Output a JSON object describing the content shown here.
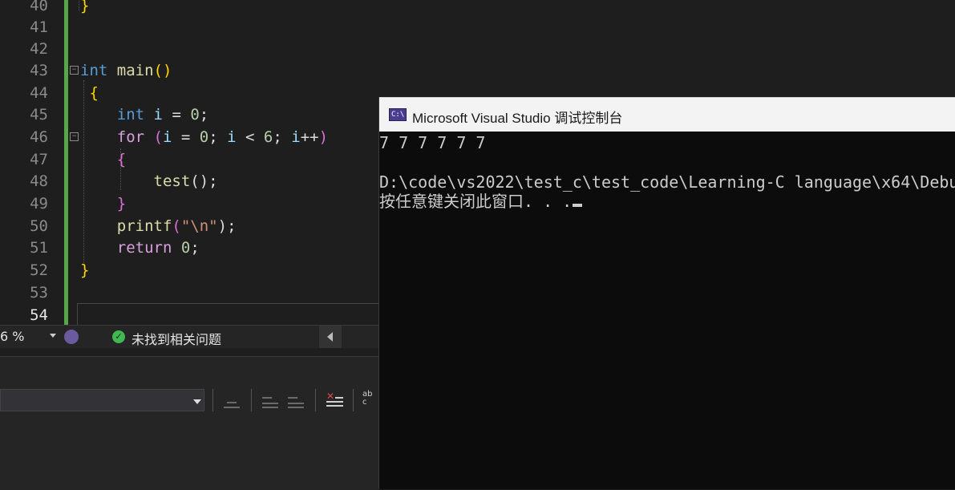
{
  "editor": {
    "line_numbers": [
      "40",
      "41",
      "42",
      "43",
      "44",
      "45",
      "46",
      "47",
      "48",
      "49",
      "50",
      "51",
      "52",
      "53",
      "54"
    ],
    "code": {
      "l40": "}",
      "l43_kw": "int",
      "l43_fn": "main",
      "l43_paren": "()",
      "l44": "{",
      "l45_kw": "int",
      "l45_var": "i",
      "l45_op": " = ",
      "l45_num": "0",
      "l45_end": ";",
      "l46_kw": "for",
      "l46_p1": " (",
      "l46_v1": "i",
      "l46_op1": " = ",
      "l46_n1": "0",
      "l46_s1": "; ",
      "l46_v2": "i",
      "l46_op2": " < ",
      "l46_n2": "6",
      "l46_s2": "; ",
      "l46_v3": "i",
      "l46_op3": "++",
      "l46_p2": ")",
      "l47": "{",
      "l48_fn": "test",
      "l48_rest": "();",
      "l49": "}",
      "l50_fn": "printf",
      "l50_p1": "(",
      "l50_str": "\"\\n\"",
      "l50_p2": ");",
      "l51_kw": "return",
      "l51_sp": " ",
      "l51_num": "0",
      "l51_end": ";",
      "l52": "}"
    }
  },
  "statusbar": {
    "zoom": "6 %",
    "issues": "未找到相关问题"
  },
  "console": {
    "title": "Microsoft Visual Studio 调试控制台",
    "icon_text": "C:\\",
    "output_line": "7 7 7 7 7 7",
    "path_line": "D:\\code\\vs2022\\test_c\\test_code\\Learning-C language\\x64\\Debu",
    "prompt_line": "按任意键关闭此窗口. . ."
  },
  "colors": {
    "keyword": "#569cd6",
    "control_keyword": "#d8a0df",
    "function": "#dcdcaa",
    "number": "#b5cea8",
    "string": "#ce9178",
    "variable": "#9cdcfe",
    "change_bar": "#57a64a",
    "ok_badge": "#3fb950"
  },
  "icons": [
    "fold-toggle-icon",
    "brush-icon",
    "check-circle-icon",
    "chevron-left-icon",
    "dropdown-arrow-icon",
    "console-app-icon"
  ]
}
